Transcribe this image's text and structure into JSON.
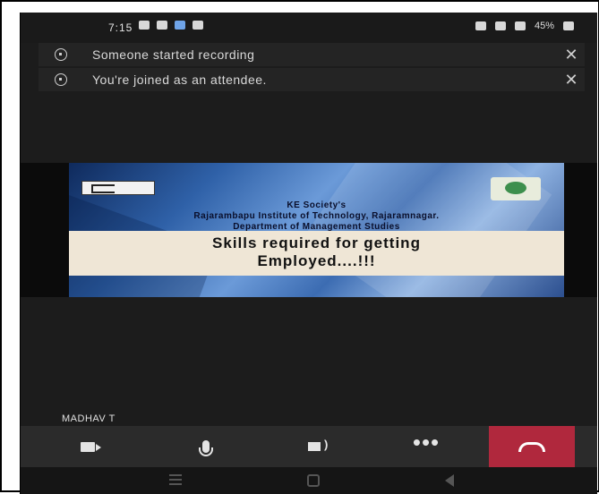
{
  "status_bar": {
    "time": "7:15",
    "battery": "45%"
  },
  "notifications": [
    {
      "icon": "info-icon",
      "text": "Someone started recording",
      "close": "✕"
    },
    {
      "icon": "info-icon",
      "text": "You're joined as an attendee.",
      "close": "✕"
    }
  ],
  "slide": {
    "org_line1": "KE Society's",
    "org_line2": "Rajarambapu Institute of Technology, Rajaramnagar.",
    "org_line3": "Department of Management Studies",
    "title_line1": "Skills required for getting",
    "title_line2": "Employed....!!!"
  },
  "participant": {
    "name": "MADHAV T"
  },
  "controls": {
    "camera": "camera-icon",
    "mic": "microphone-icon",
    "speaker": "speaker-icon",
    "more": "•••",
    "hangup": "hang-up-icon"
  },
  "colors": {
    "hangup": "#b0283d",
    "background": "#1c1c1c",
    "banner": "#242424"
  }
}
